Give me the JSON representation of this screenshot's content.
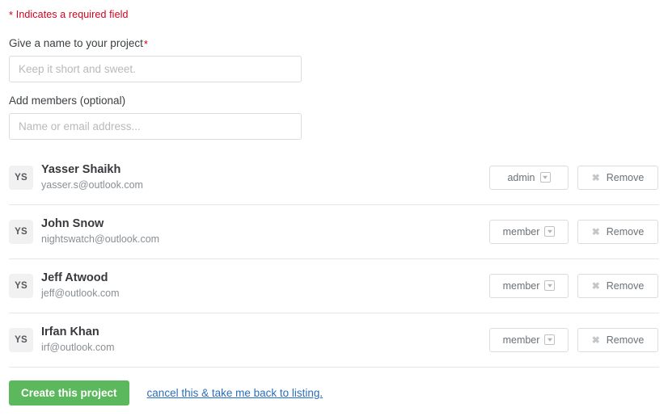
{
  "form": {
    "required_note_star": "*",
    "required_note": "Indicates a required field",
    "project_name": {
      "label": "Give a name to your project",
      "required_star": "*",
      "placeholder": "Keep it short and sweet.",
      "value": ""
    },
    "add_members": {
      "label": "Add members (optional)",
      "placeholder": "Name or email address...",
      "value": ""
    }
  },
  "members": [
    {
      "initials": "YS",
      "name": "Yasser Shaikh",
      "email": "yasser.s@outlook.com",
      "role": "admin",
      "remove_label": "Remove",
      "remove_icon": "close-icon"
    },
    {
      "initials": "YS",
      "name": "John Snow",
      "email": "nightswatch@outlook.com",
      "role": "member",
      "remove_label": "Remove",
      "remove_icon": "close-icon"
    },
    {
      "initials": "YS",
      "name": "Jeff Atwood",
      "email": "jeff@outlook.com",
      "role": "member",
      "remove_label": "Remove",
      "remove_icon": "close-icon"
    },
    {
      "initials": "YS",
      "name": "Irfan Khan",
      "email": "irf@outlook.com",
      "role": "member",
      "remove_label": "Remove",
      "remove_icon": "close-icon"
    }
  ],
  "footer": {
    "create_label": "Create this project",
    "cancel_label": "cancel this & take me back to listing."
  },
  "colors": {
    "required_red": "#d0021b",
    "primary_green": "#5cb85c",
    "link_blue": "#2a6ebb",
    "border_gray": "#dcdcdc",
    "divider_gray": "#e6e6e6",
    "avatar_bg": "#f1f1f1",
    "muted_text": "#8a8f94"
  }
}
